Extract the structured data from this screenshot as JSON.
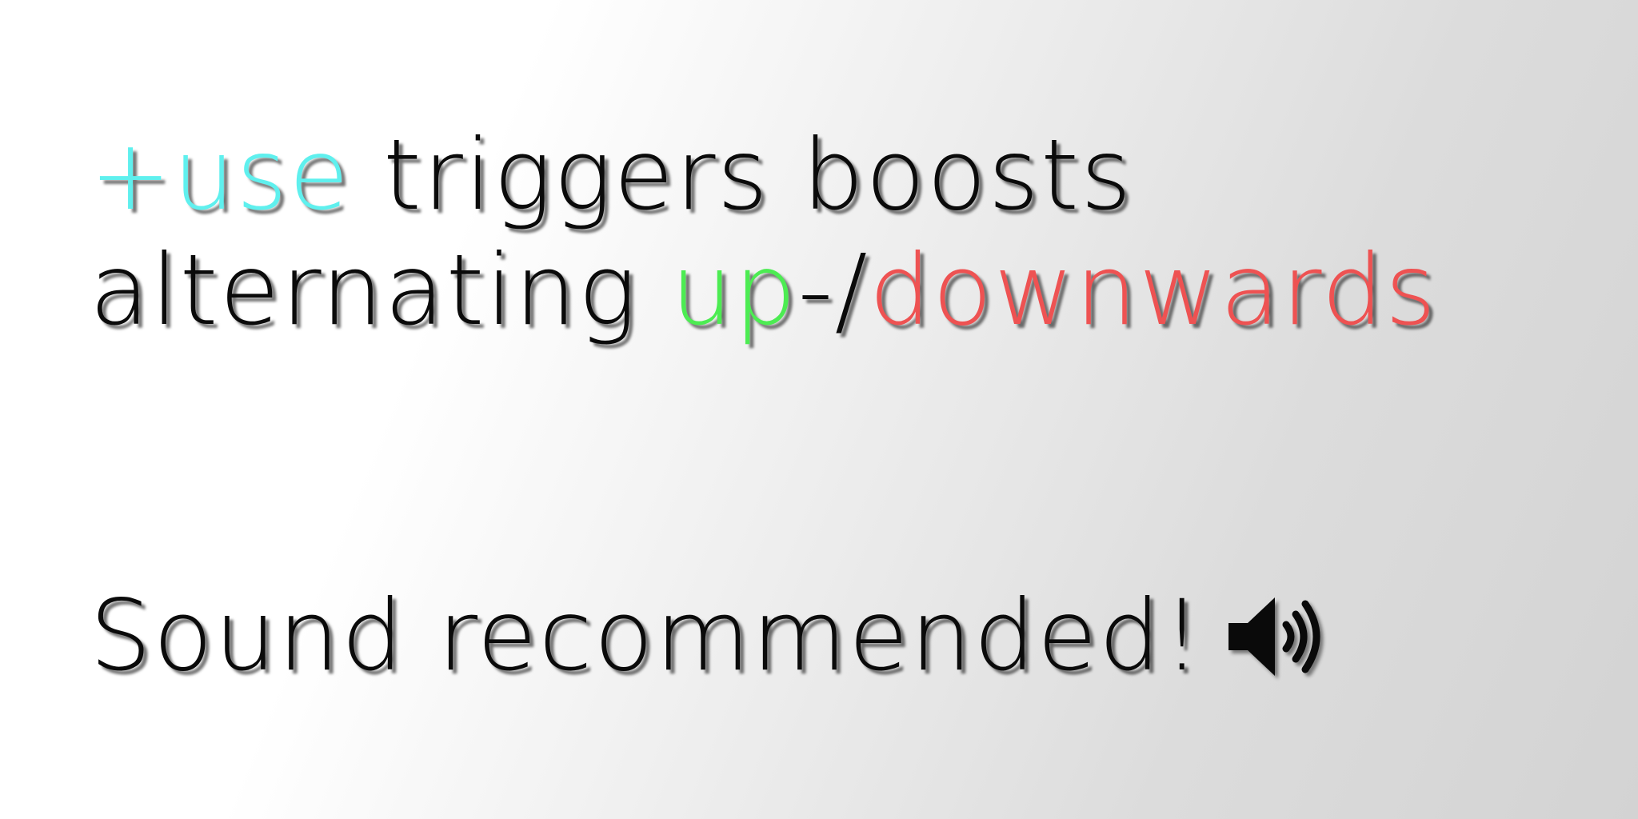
{
  "instructions": {
    "line1": {
      "key": "+use",
      "rest": " triggers boosts"
    },
    "line2": {
      "prefix": "alternating ",
      "up": "up",
      "separator": "-/",
      "down": "downwards"
    }
  },
  "sound_notice": {
    "text": "Sound recommended!",
    "icon": "speaker-volume-icon"
  },
  "colors": {
    "key_accent": "#5ff0ee",
    "up_accent": "#4cec52",
    "down_accent": "#ee5252",
    "text": "#0a0a0a"
  }
}
